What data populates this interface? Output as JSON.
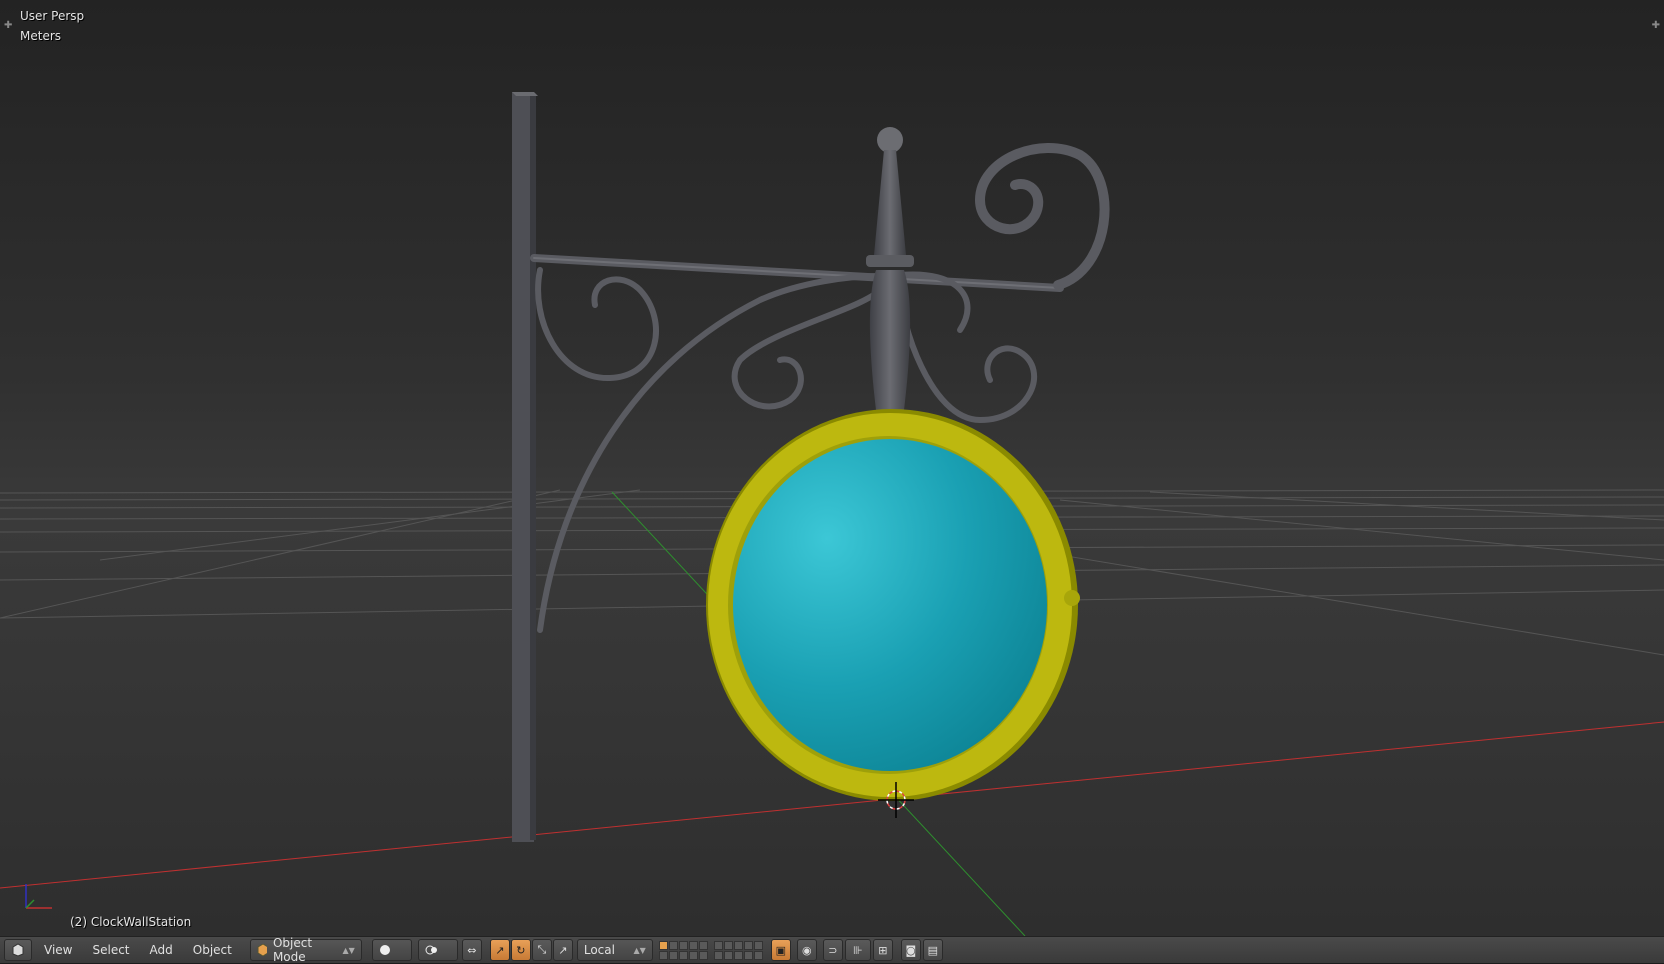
{
  "viewport": {
    "view_name": "User Persp",
    "units": "Meters",
    "active_object": "(2) ClockWallStation"
  },
  "header": {
    "editor_icon": "view3d-icon",
    "menus": [
      "View",
      "Select",
      "Add",
      "Object"
    ],
    "mode": "Object Mode",
    "orientation": "Local"
  },
  "colors": {
    "clock_face": "#1aa4b8",
    "clock_rim": "#b8b40c",
    "iron": "#55565c",
    "x_axis": "#c03030",
    "y_axis": "#2e8f2e",
    "active_tool": "#e5a04d"
  }
}
